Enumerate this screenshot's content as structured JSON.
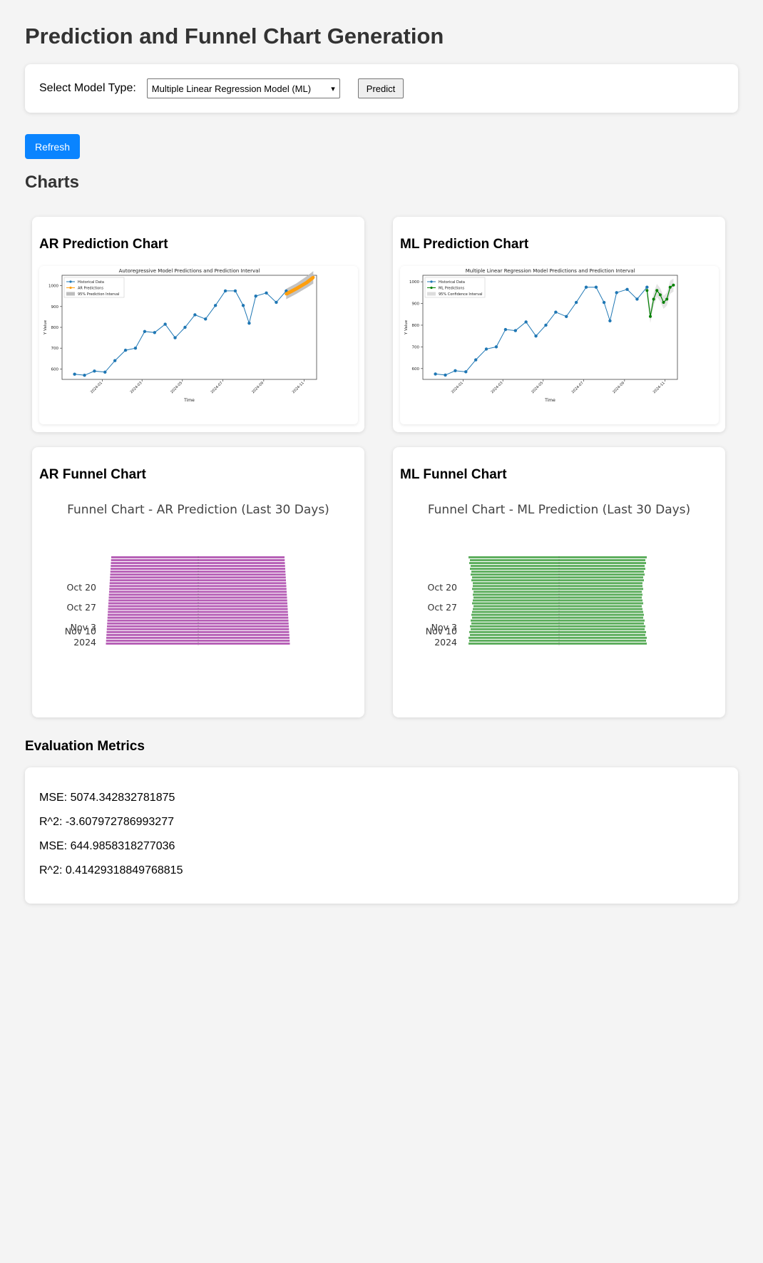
{
  "page_title": "Prediction and Funnel Chart Generation",
  "controls": {
    "select_label": "Select Model Type:",
    "model_select_value": "Multiple Linear Regression Model (ML)",
    "predict_label": "Predict",
    "refresh_label": "Refresh"
  },
  "charts_title": "Charts",
  "cards": {
    "ar_prediction_title": "AR Prediction Chart",
    "ml_prediction_title": "ML Prediction Chart",
    "ar_funnel_title": "AR Funnel Chart",
    "ml_funnel_title": "ML Funnel Chart"
  },
  "metrics": {
    "title": "Evaluation Metrics",
    "lines": [
      "MSE: 5074.342832781875",
      "R^2: -3.607972786993277",
      "MSE: 644.9858318277036",
      "R^2: 0.41429318849768815"
    ]
  },
  "colors": {
    "historical": "#1f77b4",
    "ar_pred": "#ff9f0e",
    "ml_pred": "#008000",
    "interval_grey": "#bdbdbd",
    "ar_funnel": "#b65fb6",
    "ml_funnel": "#5cad5c",
    "refresh": "#0a84ff"
  },
  "chart_data": [
    {
      "type": "line",
      "title": "Autoregressive Model Predictions and Prediction Interval",
      "xlabel": "Time",
      "ylabel": "Y Value",
      "x_ticks": [
        "2024-01",
        "2024-03",
        "2024-05",
        "2024-07",
        "2024-09",
        "2024-11"
      ],
      "y_ticks": [
        600,
        700,
        800,
        900,
        1000
      ],
      "ylim": [
        550,
        1050
      ],
      "legend": [
        "Historical Data",
        "AR Predictions",
        "95% Prediction Interval"
      ],
      "legend_position": "top-left",
      "historical": {
        "x": [
          "2023-11-20",
          "2023-12-05",
          "2023-12-20",
          "2024-01-05",
          "2024-01-20",
          "2024-02-05",
          "2024-02-20",
          "2024-03-05",
          "2024-03-20",
          "2024-04-05",
          "2024-04-20",
          "2024-05-05",
          "2024-05-20",
          "2024-06-05",
          "2024-06-20",
          "2024-07-05",
          "2024-07-20",
          "2024-08-01",
          "2024-08-10",
          "2024-08-20",
          "2024-09-05",
          "2024-09-20",
          "2024-10-05"
        ],
        "y": [
          575,
          570,
          590,
          585,
          640,
          690,
          700,
          780,
          775,
          815,
          750,
          800,
          860,
          840,
          905,
          975,
          975,
          905,
          820,
          950,
          965,
          920,
          975
        ]
      },
      "predictions": {
        "x": [
          "2024-10-05",
          "2024-10-20",
          "2024-11-05",
          "2024-11-15"
        ],
        "y": [
          960,
          985,
          1015,
          1040
        ]
      },
      "interval": {
        "lower": [
          935,
          960,
          990,
          1010
        ],
        "upper": [
          985,
          1010,
          1045,
          1070
        ]
      }
    },
    {
      "type": "line",
      "title": "Multiple Linear Regression Model Predictions and Prediction Interval",
      "xlabel": "Time",
      "ylabel": "Y Value",
      "x_ticks": [
        "2024-01",
        "2024-03",
        "2024-05",
        "2024-07",
        "2024-09",
        "2024-11"
      ],
      "y_ticks": [
        600,
        700,
        800,
        900,
        1000
      ],
      "ylim": [
        550,
        1030
      ],
      "legend": [
        "Historical Data",
        "ML Predictions",
        "95% Confidence Interval"
      ],
      "legend_position": "top-left",
      "historical": {
        "x": [
          "2023-11-20",
          "2023-12-05",
          "2023-12-20",
          "2024-01-05",
          "2024-01-20",
          "2024-02-05",
          "2024-02-20",
          "2024-03-05",
          "2024-03-20",
          "2024-04-05",
          "2024-04-20",
          "2024-05-05",
          "2024-05-20",
          "2024-06-05",
          "2024-06-20",
          "2024-07-05",
          "2024-07-20",
          "2024-08-01",
          "2024-08-10",
          "2024-08-20",
          "2024-09-05",
          "2024-09-20",
          "2024-10-05"
        ],
        "y": [
          575,
          570,
          590,
          585,
          640,
          690,
          700,
          780,
          775,
          815,
          750,
          800,
          860,
          840,
          905,
          975,
          975,
          905,
          820,
          950,
          965,
          920,
          975
        ]
      },
      "predictions": {
        "x": [
          "2024-10-05",
          "2024-10-10",
          "2024-10-15",
          "2024-10-20",
          "2024-10-25",
          "2024-10-30",
          "2024-11-04",
          "2024-11-09",
          "2024-11-14"
        ],
        "y": [
          960,
          840,
          920,
          960,
          940,
          905,
          920,
          975,
          985
        ]
      }
    },
    {
      "type": "funnel",
      "title": "Funnel Chart - AR Prediction (Last 30 Days)",
      "y_labels": [
        "Oct 20",
        "Oct 27",
        "Nov 3",
        "Nov 10\n2024"
      ],
      "series": "AR Predictions"
    },
    {
      "type": "funnel",
      "title": "Funnel Chart - ML Prediction (Last 30 Days)",
      "y_labels": [
        "Oct 20",
        "Oct 27",
        "Nov 3",
        "Nov 10\n2024"
      ],
      "series": "ML Predictions"
    }
  ]
}
